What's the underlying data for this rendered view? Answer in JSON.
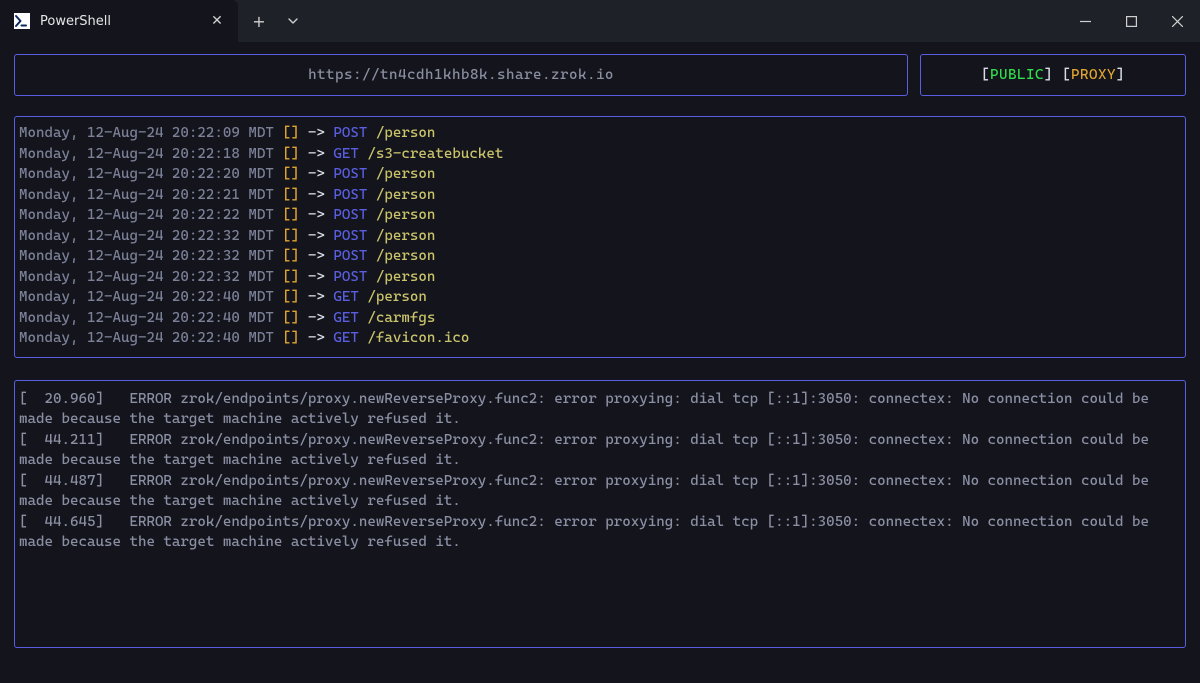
{
  "titlebar": {
    "tab_title": "PowerShell",
    "new_tab_label": "+",
    "dropdown_label": "⌄"
  },
  "header": {
    "url": "https://tn4cdh1khb8k.share.zrok.io",
    "status1": "PUBLIC",
    "status2": "PROXY"
  },
  "requests": [
    {
      "ts": "Monday, 12-Aug-24 20:22:09 MDT",
      "method": "POST",
      "path": "/person"
    },
    {
      "ts": "Monday, 12-Aug-24 20:22:18 MDT",
      "method": "GET",
      "path": "/s3-createbucket"
    },
    {
      "ts": "Monday, 12-Aug-24 20:22:20 MDT",
      "method": "POST",
      "path": "/person"
    },
    {
      "ts": "Monday, 12-Aug-24 20:22:21 MDT",
      "method": "POST",
      "path": "/person"
    },
    {
      "ts": "Monday, 12-Aug-24 20:22:22 MDT",
      "method": "POST",
      "path": "/person"
    },
    {
      "ts": "Monday, 12-Aug-24 20:22:32 MDT",
      "method": "POST",
      "path": "/person"
    },
    {
      "ts": "Monday, 12-Aug-24 20:22:32 MDT",
      "method": "POST",
      "path": "/person"
    },
    {
      "ts": "Monday, 12-Aug-24 20:22:32 MDT",
      "method": "POST",
      "path": "/person"
    },
    {
      "ts": "Monday, 12-Aug-24 20:22:40 MDT",
      "method": "GET",
      "path": "/person"
    },
    {
      "ts": "Monday, 12-Aug-24 20:22:40 MDT",
      "method": "GET",
      "path": "/carmfgs"
    },
    {
      "ts": "Monday, 12-Aug-24 20:22:40 MDT",
      "method": "GET",
      "path": "/favicon.ico"
    }
  ],
  "errors": [
    "[  20.960]   ERROR zrok/endpoints/proxy.newReverseProxy.func2: error proxying: dial tcp [::1]:3050: connectex: No connection could be made because the target machine actively refused it.",
    "[  44.211]   ERROR zrok/endpoints/proxy.newReverseProxy.func2: error proxying: dial tcp [::1]:3050: connectex: No connection could be made because the target machine actively refused it.",
    "[  44.487]   ERROR zrok/endpoints/proxy.newReverseProxy.func2: error proxying: dial tcp [::1]:3050: connectex: No connection could be made because the target machine actively refused it.",
    "[  44.645]   ERROR zrok/endpoints/proxy.newReverseProxy.func2: error proxying: dial tcp [::1]:3050: connectex: No connection could be made because the target machine actively refused it."
  ]
}
